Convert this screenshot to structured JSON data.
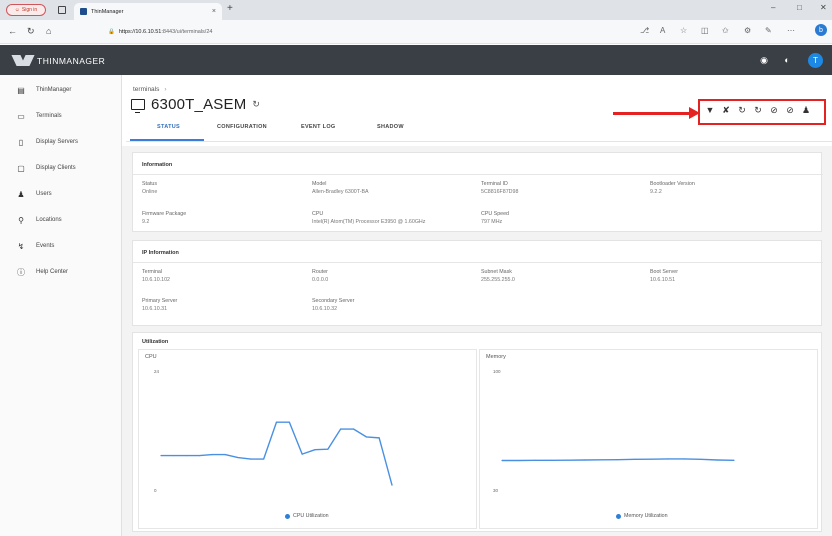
{
  "browser": {
    "signin_label": "Sign in",
    "tab_title": "ThinManager",
    "url_host": "https://10.6.10.51:",
    "url_path": "8443/ui/terminals/24",
    "close_tab": "×",
    "new_tab": "+"
  },
  "app": {
    "logo_text": "THINMANAGER",
    "avatar_letter": "T"
  },
  "sidebar": {
    "items": [
      {
        "label": "ThinManager",
        "icon": "thinmanager-icon"
      },
      {
        "label": "Terminals",
        "icon": "terminal-icon"
      },
      {
        "label": "Display Servers",
        "icon": "server-icon"
      },
      {
        "label": "Display Clients",
        "icon": "monitor-icon"
      },
      {
        "label": "Users",
        "icon": "user-icon"
      },
      {
        "label": "Locations",
        "icon": "location-icon"
      },
      {
        "label": "Events",
        "icon": "events-icon"
      },
      {
        "label": "Help Center",
        "icon": "help-icon"
      }
    ]
  },
  "page": {
    "breadcrumb": "terminals",
    "breadcrumb_sep": "›",
    "title": "6300T_ASEM",
    "tabs": [
      "STATUS",
      "CONFIGURATION",
      "EVENT LOG",
      "SHADOW"
    ]
  },
  "actions": [
    "power-plug-icon",
    "unplug-icon",
    "restart-icon",
    "reboot-icon",
    "block-icon",
    "disable-icon",
    "user-login-icon"
  ],
  "information": {
    "heading": "Information",
    "fields": [
      {
        "label": "Status",
        "value": "Online"
      },
      {
        "label": "Model",
        "value": "Allen-Bradley 6300T-BA"
      },
      {
        "label": "Terminal ID",
        "value": "5C8816F87D98"
      },
      {
        "label": "Bootloader Version",
        "value": "9.2.2"
      },
      {
        "label": "Firmware Package",
        "value": "9.2"
      },
      {
        "label": "CPU",
        "value": "Intel(R) Atom(TM) Processor E3950 @ 1.60GHz"
      },
      {
        "label": "CPU Speed",
        "value": "797 MHz"
      }
    ]
  },
  "ip": {
    "heading": "IP Information",
    "fields": [
      {
        "label": "Terminal",
        "value": "10.6.10.102"
      },
      {
        "label": "Router",
        "value": "0.0.0.0"
      },
      {
        "label": "Subnet Mask",
        "value": "255.255.255.0"
      },
      {
        "label": "Boot Server",
        "value": "10.6.10.51"
      },
      {
        "label": "Primary Server",
        "value": "10.6.10.31"
      },
      {
        "label": "Secondary Server",
        "value": "10.6.10.32"
      }
    ]
  },
  "utilization": {
    "heading": "Utilization",
    "cpu": {
      "title": "CPU",
      "ymax_label": "24",
      "ymin_label": "0",
      "legend": "CPU Utilization"
    },
    "memory": {
      "title": "Memory",
      "ymax_label": "100",
      "ymin_label": "30",
      "legend": "Memory Utilization"
    }
  },
  "chart_data": [
    {
      "type": "line",
      "title": "CPU",
      "ylim": [
        0,
        24
      ],
      "series": [
        {
          "name": "CPU Utilization",
          "values": [
            7,
            7,
            7,
            7,
            7.2,
            7.2,
            6.6,
            6.3,
            6.3,
            13.8,
            13.8,
            7.3,
            8.2,
            8.3,
            12.4,
            12.4,
            10.8,
            10.6,
            1
          ]
        }
      ],
      "color": "#4a90e2"
    },
    {
      "type": "line",
      "title": "Memory",
      "ylim": [
        30,
        100
      ],
      "series": [
        {
          "name": "Memory Utilization",
          "values": [
            47.5,
            47.5,
            47.6,
            47.6,
            47.7,
            47.8,
            47.9,
            48.0,
            48.2,
            48.3,
            48.4,
            48.4,
            48.2,
            47.8,
            47.6
          ]
        }
      ],
      "color": "#4a90e2"
    }
  ]
}
